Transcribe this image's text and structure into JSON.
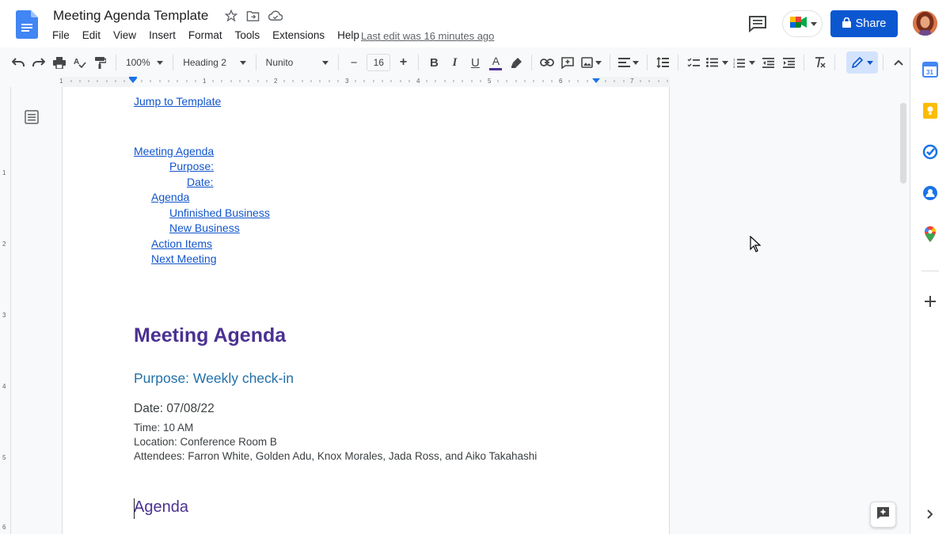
{
  "header": {
    "doc_title": "Meeting Agenda Template",
    "last_edit": "Last edit was 16 minutes ago",
    "share_label": "Share"
  },
  "menu": {
    "items": [
      "File",
      "Edit",
      "View",
      "Insert",
      "Format",
      "Tools",
      "Extensions",
      "Help"
    ]
  },
  "toolbar": {
    "zoom": "100%",
    "style": "Heading 2",
    "font": "Nunito",
    "font_size": "16",
    "minus": "−",
    "plus": "+",
    "bold": "B",
    "italic": "I",
    "underline": "U",
    "text_color": "A"
  },
  "ruler": {
    "labels": [
      "1",
      "1",
      "2",
      "3",
      "4",
      "5",
      "6",
      "7"
    ]
  },
  "vruler": {
    "labels": [
      "1",
      "2",
      "3",
      "4",
      "5",
      "6"
    ]
  },
  "document": {
    "jump_link": "Jump to Template",
    "toc": [
      "Meeting Agenda",
      "Purpose:",
      "Date:",
      "Agenda",
      "Unfinished Business",
      "New Business",
      "Action Items",
      "Next Meeting"
    ],
    "heading1": "Meeting Agenda",
    "heading2": "Purpose: Weekly check-in",
    "heading3": "Date: 07/08/22",
    "time": "Time: 10 AM",
    "location": "Location: Conference Room B",
    "attendees": "Attendees: Farron White, Golden Adu, Knox Morales, Jada Ross, and Aiko Takahashi",
    "agenda_heading": "Agenda"
  },
  "colors": {
    "accent": "#0b57d0",
    "heading1": "#4b3191",
    "heading2": "#2270a8",
    "link": "#1155cc"
  }
}
